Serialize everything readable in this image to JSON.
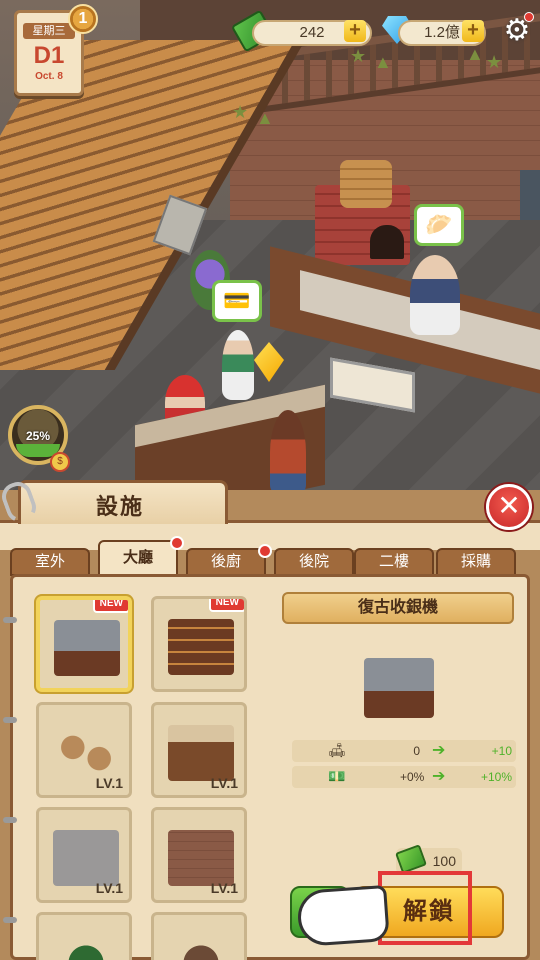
{
  "hud": {
    "weekday": "星期三",
    "day": "D1",
    "date": "Oct. 8",
    "badge_count": "1",
    "cash": "242",
    "gems": "1.2億",
    "plus_symbol": "+",
    "gear_glyph": "⚙",
    "progress_pct": "25%",
    "progress_value": 0.25,
    "coin_glyph": "$"
  },
  "panel": {
    "title": "設施",
    "close_glyph": "✕",
    "tabs": [
      {
        "label": "室外",
        "active": false,
        "dot": false
      },
      {
        "label": "大廳",
        "active": true,
        "dot": true
      },
      {
        "label": "後廚",
        "active": false,
        "dot": true
      },
      {
        "label": "後院",
        "active": false,
        "dot": false
      },
      {
        "label": "二樓",
        "active": false,
        "dot": false
      },
      {
        "label": "採購",
        "active": false,
        "dot": false
      }
    ],
    "items": [
      {
        "name": "cash-register",
        "badge": "NEW",
        "level": ""
      },
      {
        "name": "shelf",
        "badge": "NEW",
        "level": ""
      },
      {
        "name": "tables",
        "badge": "",
        "level": "LV.1"
      },
      {
        "name": "counter",
        "badge": "",
        "level": "LV.1"
      },
      {
        "name": "floor",
        "badge": "",
        "level": "LV.1"
      },
      {
        "name": "wall",
        "badge": "",
        "level": "LV.1"
      },
      {
        "name": "plant",
        "badge": "",
        "level": ""
      },
      {
        "name": "clock",
        "badge": "",
        "level": ""
      }
    ],
    "detail": {
      "title": "復古收銀機",
      "stats": [
        {
          "icon": "🛋",
          "from": "0",
          "to": "+10"
        },
        {
          "icon": "💵",
          "from": "+0%",
          "to": "+10%"
        }
      ],
      "arrow_glyph": "➔",
      "price": "100",
      "unlock_label": "解鎖"
    }
  }
}
